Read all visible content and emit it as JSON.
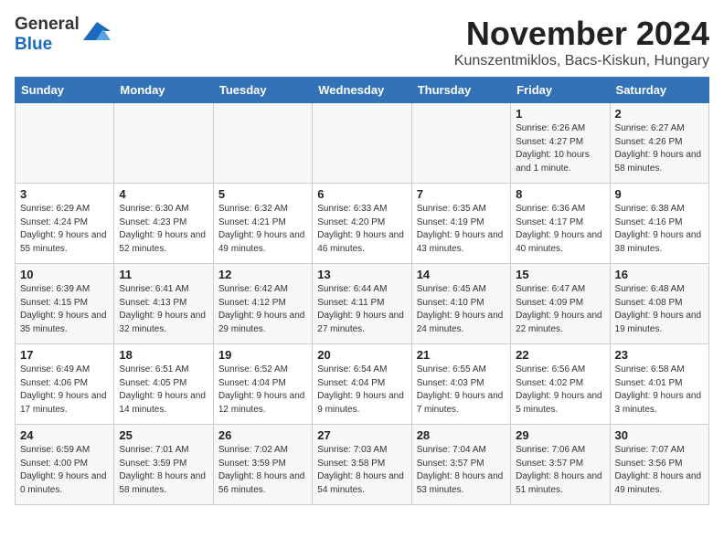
{
  "header": {
    "logo_general": "General",
    "logo_blue": "Blue",
    "month_title": "November 2024",
    "location": "Kunszentmiklos, Bacs-Kiskun, Hungary"
  },
  "weekdays": [
    "Sunday",
    "Monday",
    "Tuesday",
    "Wednesday",
    "Thursday",
    "Friday",
    "Saturday"
  ],
  "weeks": [
    [
      {
        "day": "",
        "info": ""
      },
      {
        "day": "",
        "info": ""
      },
      {
        "day": "",
        "info": ""
      },
      {
        "day": "",
        "info": ""
      },
      {
        "day": "",
        "info": ""
      },
      {
        "day": "1",
        "info": "Sunrise: 6:26 AM\nSunset: 4:27 PM\nDaylight: 10 hours\nand 1 minute."
      },
      {
        "day": "2",
        "info": "Sunrise: 6:27 AM\nSunset: 4:26 PM\nDaylight: 9 hours\nand 58 minutes."
      }
    ],
    [
      {
        "day": "3",
        "info": "Sunrise: 6:29 AM\nSunset: 4:24 PM\nDaylight: 9 hours\nand 55 minutes."
      },
      {
        "day": "4",
        "info": "Sunrise: 6:30 AM\nSunset: 4:23 PM\nDaylight: 9 hours\nand 52 minutes."
      },
      {
        "day": "5",
        "info": "Sunrise: 6:32 AM\nSunset: 4:21 PM\nDaylight: 9 hours\nand 49 minutes."
      },
      {
        "day": "6",
        "info": "Sunrise: 6:33 AM\nSunset: 4:20 PM\nDaylight: 9 hours\nand 46 minutes."
      },
      {
        "day": "7",
        "info": "Sunrise: 6:35 AM\nSunset: 4:19 PM\nDaylight: 9 hours\nand 43 minutes."
      },
      {
        "day": "8",
        "info": "Sunrise: 6:36 AM\nSunset: 4:17 PM\nDaylight: 9 hours\nand 40 minutes."
      },
      {
        "day": "9",
        "info": "Sunrise: 6:38 AM\nSunset: 4:16 PM\nDaylight: 9 hours\nand 38 minutes."
      }
    ],
    [
      {
        "day": "10",
        "info": "Sunrise: 6:39 AM\nSunset: 4:15 PM\nDaylight: 9 hours\nand 35 minutes."
      },
      {
        "day": "11",
        "info": "Sunrise: 6:41 AM\nSunset: 4:13 PM\nDaylight: 9 hours\nand 32 minutes."
      },
      {
        "day": "12",
        "info": "Sunrise: 6:42 AM\nSunset: 4:12 PM\nDaylight: 9 hours\nand 29 minutes."
      },
      {
        "day": "13",
        "info": "Sunrise: 6:44 AM\nSunset: 4:11 PM\nDaylight: 9 hours\nand 27 minutes."
      },
      {
        "day": "14",
        "info": "Sunrise: 6:45 AM\nSunset: 4:10 PM\nDaylight: 9 hours\nand 24 minutes."
      },
      {
        "day": "15",
        "info": "Sunrise: 6:47 AM\nSunset: 4:09 PM\nDaylight: 9 hours\nand 22 minutes."
      },
      {
        "day": "16",
        "info": "Sunrise: 6:48 AM\nSunset: 4:08 PM\nDaylight: 9 hours\nand 19 minutes."
      }
    ],
    [
      {
        "day": "17",
        "info": "Sunrise: 6:49 AM\nSunset: 4:06 PM\nDaylight: 9 hours\nand 17 minutes."
      },
      {
        "day": "18",
        "info": "Sunrise: 6:51 AM\nSunset: 4:05 PM\nDaylight: 9 hours\nand 14 minutes."
      },
      {
        "day": "19",
        "info": "Sunrise: 6:52 AM\nSunset: 4:04 PM\nDaylight: 9 hours\nand 12 minutes."
      },
      {
        "day": "20",
        "info": "Sunrise: 6:54 AM\nSunset: 4:04 PM\nDaylight: 9 hours\nand 9 minutes."
      },
      {
        "day": "21",
        "info": "Sunrise: 6:55 AM\nSunset: 4:03 PM\nDaylight: 9 hours\nand 7 minutes."
      },
      {
        "day": "22",
        "info": "Sunrise: 6:56 AM\nSunset: 4:02 PM\nDaylight: 9 hours\nand 5 minutes."
      },
      {
        "day": "23",
        "info": "Sunrise: 6:58 AM\nSunset: 4:01 PM\nDaylight: 9 hours\nand 3 minutes."
      }
    ],
    [
      {
        "day": "24",
        "info": "Sunrise: 6:59 AM\nSunset: 4:00 PM\nDaylight: 9 hours\nand 0 minutes."
      },
      {
        "day": "25",
        "info": "Sunrise: 7:01 AM\nSunset: 3:59 PM\nDaylight: 8 hours\nand 58 minutes."
      },
      {
        "day": "26",
        "info": "Sunrise: 7:02 AM\nSunset: 3:59 PM\nDaylight: 8 hours\nand 56 minutes."
      },
      {
        "day": "27",
        "info": "Sunrise: 7:03 AM\nSunset: 3:58 PM\nDaylight: 8 hours\nand 54 minutes."
      },
      {
        "day": "28",
        "info": "Sunrise: 7:04 AM\nSunset: 3:57 PM\nDaylight: 8 hours\nand 53 minutes."
      },
      {
        "day": "29",
        "info": "Sunrise: 7:06 AM\nSunset: 3:57 PM\nDaylight: 8 hours\nand 51 minutes."
      },
      {
        "day": "30",
        "info": "Sunrise: 7:07 AM\nSunset: 3:56 PM\nDaylight: 8 hours\nand 49 minutes."
      }
    ]
  ]
}
